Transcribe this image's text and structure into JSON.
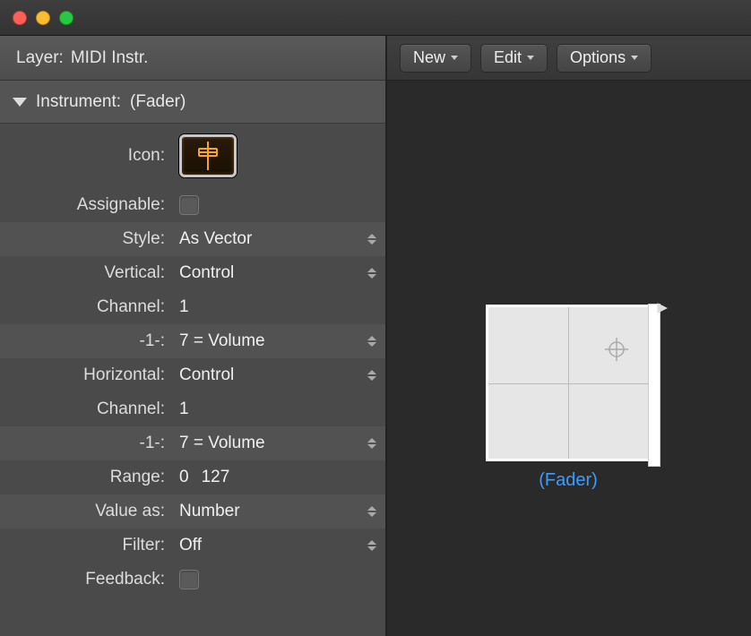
{
  "layer": {
    "label": "Layer:",
    "name": "MIDI Instr."
  },
  "section": {
    "label": "Instrument:",
    "name": "(Fader)"
  },
  "props": {
    "icon_label": "Icon:",
    "assignable_label": "Assignable:",
    "style": {
      "label": "Style:",
      "value": "As Vector"
    },
    "vertical": {
      "label": "Vertical:",
      "value": "Control"
    },
    "v_channel": {
      "label": "Channel:",
      "value": "1"
    },
    "v_cc": {
      "label": "-1-:",
      "value": "7 = Volume"
    },
    "horizontal": {
      "label": "Horizontal:",
      "value": "Control"
    },
    "h_channel": {
      "label": "Channel:",
      "value": "1"
    },
    "h_cc": {
      "label": "-1-:",
      "value": "7 = Volume"
    },
    "range": {
      "label": "Range:",
      "lo": "0",
      "hi": "127"
    },
    "value_as": {
      "label": "Value as:",
      "value": "Number"
    },
    "filter": {
      "label": "Filter:",
      "value": "Off"
    },
    "feedback_label": "Feedback:"
  },
  "toolbar": {
    "new": "New",
    "edit": "Edit",
    "options": "Options"
  },
  "canvas": {
    "object_label": "(Fader)"
  }
}
